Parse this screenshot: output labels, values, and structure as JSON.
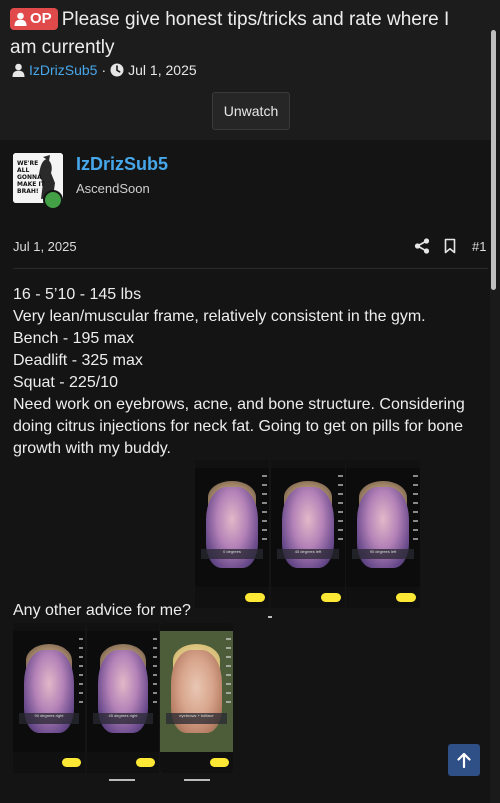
{
  "thread": {
    "op_badge": "OP",
    "title": "Please give honest tips/tricks and rate where I am currently",
    "author": "IzDrizSub5",
    "separator": "·",
    "date": "Jul 1, 2025",
    "unwatch_label": "Unwatch"
  },
  "post": {
    "username": "IzDrizSub5",
    "user_title": "AscendSoon",
    "avatar_text": [
      "WE'RE",
      "ALL",
      "GONNA",
      "MAKE IT",
      "BRAH!"
    ],
    "date": "Jul 1, 2025",
    "number": "#1",
    "lines": [
      "16 - 5’10 - 145 lbs",
      "Very lean/muscular frame, relatively consistent in the gym.",
      "Bench - 195 max",
      "Deadlift - 325 max",
      "Squat - 225/10",
      "Need work on eyebrows, acne, and bone structure. Considering doing citrus injections for neck fat. Going to get on pills for bone growth with my buddy."
    ],
    "question": "Any other advice for me?",
    "attachments": [
      {
        "caption": "0 degrees",
        "kind": "phone-screenshot"
      },
      {
        "caption": "45 degrees left",
        "kind": "phone-screenshot"
      },
      {
        "caption": "90 degrees left",
        "kind": "phone-screenshot"
      },
      {
        "caption": "90 degrees right",
        "kind": "phone-screenshot"
      },
      {
        "caption": "45 degrees right",
        "kind": "phone-screenshot"
      },
      {
        "caption": "eyebrows + fullface",
        "kind": "phone-screenshot"
      }
    ]
  },
  "icons": {
    "user": "user-icon",
    "clock": "clock-icon",
    "share": "share-icon",
    "bookmark": "bookmark-icon",
    "scroll_top": "arrow-up-icon"
  },
  "colors": {
    "link": "#47a7eb",
    "op_badge": "#e04a4a",
    "online": "#43a047",
    "scroll_button": "#2f4f87"
  }
}
